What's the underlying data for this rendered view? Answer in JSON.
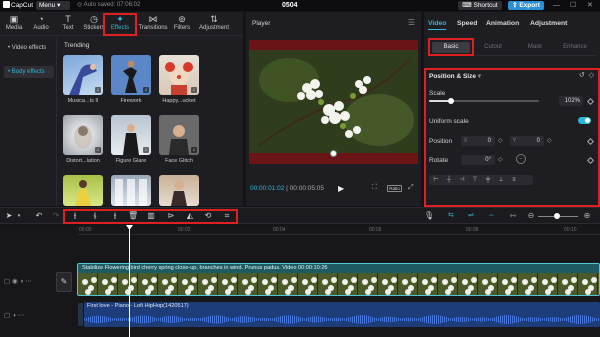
{
  "titlebar": {
    "app_name": "CapCut",
    "menu_label": "Menu",
    "autosave": "Auto saved: 07:06:02",
    "project_title": "0504",
    "shortcut_label": "Shortcut",
    "export_label": "Export"
  },
  "media_tabs": [
    {
      "label": "Media",
      "icon": "media-icon"
    },
    {
      "label": "Audio",
      "icon": "audio-icon"
    },
    {
      "label": "Text",
      "icon": "text-icon"
    },
    {
      "label": "Stickers",
      "icon": "stickers-icon"
    },
    {
      "label": "Effects",
      "icon": "effects-icon",
      "active": true
    },
    {
      "label": "Transitions",
      "icon": "transitions-icon"
    },
    {
      "label": "Filters",
      "icon": "filters-icon"
    },
    {
      "label": "Adjustment",
      "icon": "adjustment-icon"
    }
  ],
  "effect_categories": [
    "• Video effects",
    "• Body effects"
  ],
  "trending_label": "Trending",
  "effects": [
    {
      "label": "Musica...ts II"
    },
    {
      "label": "Firework"
    },
    {
      "label": "Happy...ucket"
    },
    {
      "label": "Distort...lation"
    },
    {
      "label": "Figure Glare"
    },
    {
      "label": "Face Glitch"
    },
    {
      "label": ""
    },
    {
      "label": ""
    },
    {
      "label": ""
    }
  ],
  "player": {
    "title": "Player",
    "time_current": "00:00:01:02",
    "time_total": "00:00:05:05",
    "ratio_label": "Ratio"
  },
  "inspector": {
    "tabs": [
      "Video",
      "Speed",
      "Animation",
      "Adjustment"
    ],
    "subtabs": [
      "Basic",
      "Cutout",
      "Mask",
      "Enhance"
    ],
    "section_title": "Position & Size",
    "scale_label": "Scale",
    "scale_value": "102%",
    "scale_fraction": 0.2,
    "uniform_scale_label": "Uniform scale",
    "uniform_scale_on": true,
    "position_label": "Position",
    "position_x_axis": "X",
    "position_x": "0",
    "position_y_axis": "Y",
    "position_y": "0",
    "rotate_label": "Rotate",
    "rotate_value": "0°"
  },
  "timeline": {
    "ruler": [
      "00:00",
      "00:02",
      "00:04",
      "00:06",
      "00:08",
      "00:10"
    ],
    "video_clip_label": "Stabilize  Flowering bird cherry spring close-up, branches in wind. Prunus padus. Video  00:00:10:26",
    "audio_clip_label": "First love - Piano - Lofi HipHop(1420517)"
  },
  "colors": {
    "accent": "#34b7d6",
    "highlight_box": "#e02020",
    "export_button": "#2b8fd8",
    "video_clip": "#1e5a62",
    "audio_clip": "#1d3d7a"
  }
}
